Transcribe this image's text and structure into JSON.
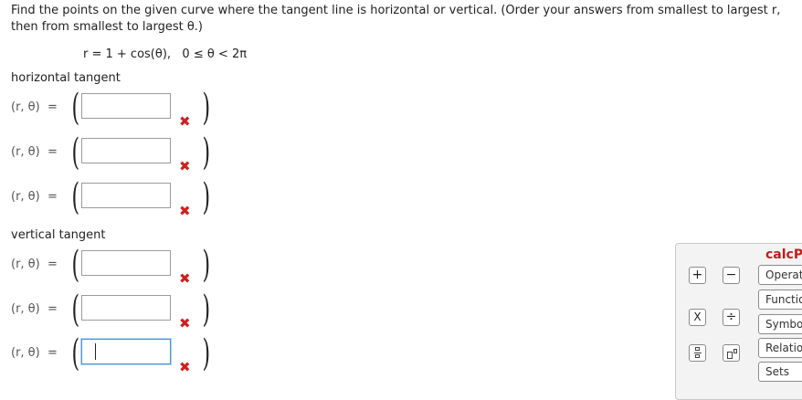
{
  "question": {
    "text": "Find the points on the given curve where the tangent line is horizontal or vertical. (Order your answers from smallest to largest r, then from smallest to largest θ.)",
    "equation": "r = 1 + cos(θ),   0 ≤ θ < 2π"
  },
  "horizontal": {
    "label": "horizontal tangent",
    "rows": [
      {
        "label": "(r, θ)  =",
        "value": ""
      },
      {
        "label": "(r, θ)  =",
        "value": ""
      },
      {
        "label": "(r, θ)  =",
        "value": ""
      }
    ]
  },
  "vertical": {
    "label": "vertical tangent",
    "rows": [
      {
        "label": "(r, θ)  =",
        "value": ""
      },
      {
        "label": "(r, θ)  =",
        "value": ""
      },
      {
        "label": "(r, θ)  =",
        "value": ""
      }
    ]
  },
  "parens": {
    "open": "(",
    "close": ")"
  },
  "incorrect_mark": "✖",
  "colors": {
    "incorrect": "#d21f1f",
    "palette_title": "#c31d1d",
    "active_border": "#4a90d9"
  },
  "palette": {
    "title": "calcP",
    "buttons": {
      "plus": "+",
      "minus": "−",
      "times": "X",
      "divide": "÷"
    },
    "icons": {
      "fraction": "fraction-icon",
      "power": "power-icon"
    },
    "categories": [
      "Operat",
      "Functio",
      "Symbo",
      "Relatio",
      "Sets"
    ]
  }
}
